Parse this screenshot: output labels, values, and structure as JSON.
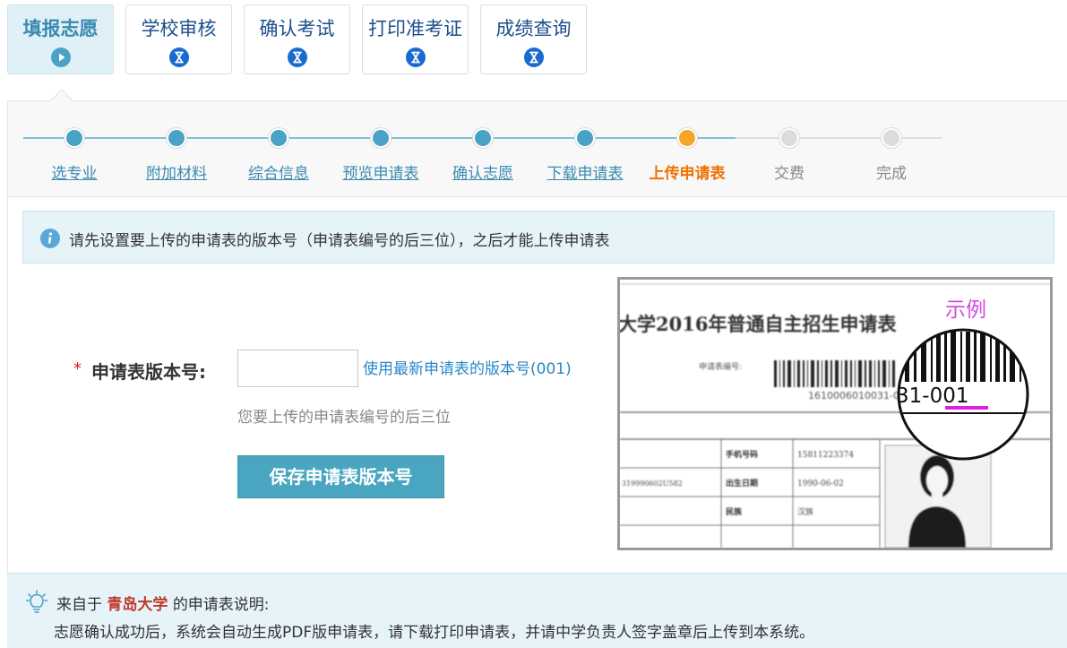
{
  "tabs": [
    {
      "label": "填报志愿",
      "icon": "play-icon",
      "active": true
    },
    {
      "label": "学校审核",
      "icon": "hourglass-icon",
      "active": false
    },
    {
      "label": "确认考试",
      "icon": "hourglass-icon",
      "active": false
    },
    {
      "label": "打印准考证",
      "icon": "hourglass-icon",
      "active": false
    },
    {
      "label": "成绩查询",
      "icon": "hourglass-icon",
      "active": false
    }
  ],
  "steps": [
    {
      "label": "选专业",
      "state": "done"
    },
    {
      "label": "附加材料",
      "state": "done"
    },
    {
      "label": "综合信息",
      "state": "done"
    },
    {
      "label": "预览申请表",
      "state": "done"
    },
    {
      "label": "确认志愿",
      "state": "done"
    },
    {
      "label": "下载申请表",
      "state": "done"
    },
    {
      "label": "上传申请表",
      "state": "current"
    },
    {
      "label": "交费",
      "state": "todo"
    },
    {
      "label": "完成",
      "state": "todo"
    }
  ],
  "info": {
    "text": "请先设置要上传的申请表的版本号（申请表编号的后三位），之后才能上传申请表"
  },
  "form": {
    "required_mark": "*",
    "label": "申请表版本号:",
    "input_value": "",
    "latest_link": "使用最新申请表的版本号(001)",
    "hint": "您要上传的申请表编号的后三位",
    "save_button": "保存申请表版本号"
  },
  "example": {
    "tag": "示例",
    "form_title": "大学2016年普通自主招生申请表",
    "form_no_label": "申请表编号:",
    "barcode_number": "1610006010031-001",
    "zoom_text": "31-001",
    "rows": [
      {
        "label": "手机号码",
        "value": "15811223374"
      },
      {
        "label": "出生日期",
        "value": "1990-06-02",
        "left": "319990602U582"
      },
      {
        "label": "民族",
        "value": "汉族"
      }
    ]
  },
  "note": {
    "prefix": "来自于",
    "school": "青岛大学",
    "suffix": "的申请表说明:",
    "body": "志愿确认成功后，系统会自动生成PDF版申请表，请下载打印申请表，并请中学负责人签字盖章后上传到本系统。"
  },
  "colors": {
    "accent": "#4aa6c0",
    "step_done": "#4aa3c6",
    "step_current": "#f5a623",
    "step_todo": "#dcdcdc",
    "link": "#2a86c9",
    "school": "#c0392b"
  }
}
